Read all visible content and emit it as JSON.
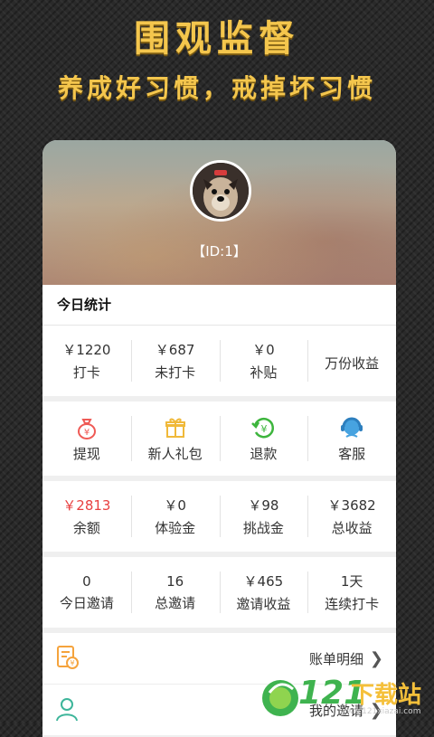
{
  "hero": {
    "title": "围观监督",
    "subtitle": "养成好习惯，戒掉坏习惯"
  },
  "profile": {
    "id_label": "【ID:1】"
  },
  "today": {
    "title": "今日统计"
  },
  "stats_row1": [
    {
      "value": "￥1220",
      "label": "打卡"
    },
    {
      "value": "￥687",
      "label": "未打卡"
    },
    {
      "value": "￥0",
      "label": "补贴"
    },
    {
      "value": "",
      "label": "万份收益"
    }
  ],
  "actions": [
    {
      "label": "提现",
      "icon": "money-bag-icon"
    },
    {
      "label": "新人礼包",
      "icon": "gift-icon"
    },
    {
      "label": "退款",
      "icon": "refund-icon"
    },
    {
      "label": "客服",
      "icon": "customer-service-icon"
    }
  ],
  "stats_row2": [
    {
      "value": "￥2813",
      "label": "余额"
    },
    {
      "value": "￥0",
      "label": "体验金"
    },
    {
      "value": "￥98",
      "label": "挑战金"
    },
    {
      "value": "￥3682",
      "label": "总收益"
    }
  ],
  "stats_row3": [
    {
      "value": "0",
      "label": "今日邀请"
    },
    {
      "value": "16",
      "label": "总邀请"
    },
    {
      "value": "￥465",
      "label": "邀请收益"
    },
    {
      "value": "1天",
      "label": "连续打卡"
    }
  ],
  "menu": [
    {
      "label": "账单明细",
      "icon": "bill-icon"
    },
    {
      "label": "我的邀请",
      "icon": "user-icon"
    }
  ],
  "watermark": {
    "number": "121",
    "text": "下载站",
    "domain": "www.121xiazai.com"
  },
  "colors": {
    "accent": "#f4c64d",
    "red": "#e83f3f",
    "green": "#3db53d",
    "blue": "#47a3e0",
    "orange": "#f5a33c"
  }
}
